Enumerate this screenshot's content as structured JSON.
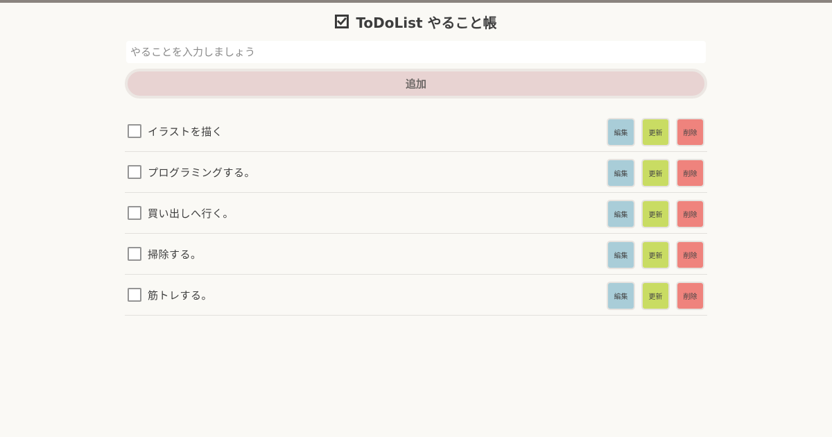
{
  "app": {
    "title": "ToDoList やること帳"
  },
  "form": {
    "placeholder": "やることを入力しましょう",
    "value": "",
    "add_label": "追加"
  },
  "tasks": [
    {
      "text": "イラストを描く",
      "checked": false,
      "edit_label": "編集",
      "update_label": "更新",
      "delete_label": "削除"
    },
    {
      "text": "プログラミングする。",
      "checked": false,
      "edit_label": "編集",
      "update_label": "更新",
      "delete_label": "削除"
    },
    {
      "text": "買い出しへ行く。",
      "checked": false,
      "edit_label": "編集",
      "update_label": "更新",
      "delete_label": "削除"
    },
    {
      "text": "掃除する。",
      "checked": false,
      "edit_label": "編集",
      "update_label": "更新",
      "delete_label": "削除"
    },
    {
      "text": "筋トレする。",
      "checked": false,
      "edit_label": "編集",
      "update_label": "更新",
      "delete_label": "削除"
    }
  ],
  "colors": {
    "background": "#faf9f5",
    "add_button": "#e8d3d2",
    "edit_button": "#a9cdd8",
    "update_button": "#c9dc63",
    "delete_button": "#ef837d"
  },
  "icons": {
    "title": "checked-box-icon",
    "task": "checkbox-icon"
  }
}
